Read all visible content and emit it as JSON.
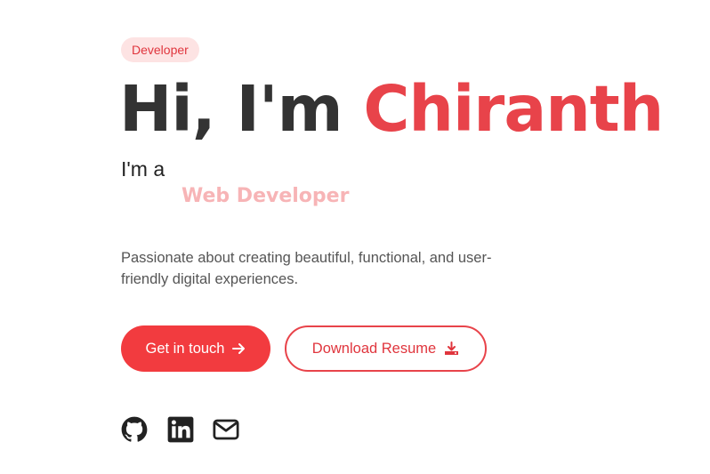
{
  "hero": {
    "badge": "Developer",
    "greeting": "Hi, I'm ",
    "name": "Chiranth",
    "intro": "I'm a",
    "role": "Web Developer",
    "description": "Passionate about creating beautiful, functional, and user-friendly digital experiences."
  },
  "buttons": {
    "contact_label": "Get in touch",
    "contact_icon": "arrow-right-icon",
    "resume_label": "Download Resume",
    "resume_icon": "download-icon"
  },
  "socials": [
    {
      "icon": "github-icon"
    },
    {
      "icon": "linkedin-icon"
    },
    {
      "icon": "mail-icon"
    }
  ],
  "colors": {
    "accent": "#e8434a",
    "button_fill": "#f23b3f",
    "badge_bg": "#fde3e3",
    "role_text": "#f7b4b6",
    "heading_text": "#333333"
  }
}
